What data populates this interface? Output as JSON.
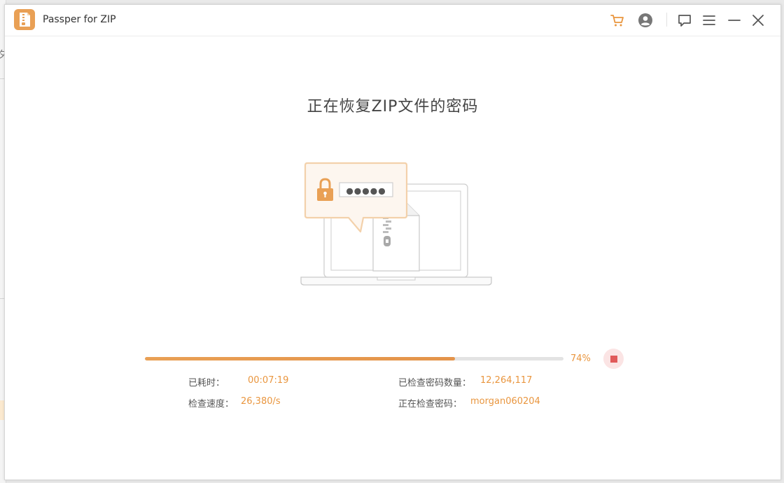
{
  "window": {
    "title": "Passper for ZIP"
  },
  "titlebar": {
    "icons": [
      "cart-icon",
      "account-icon",
      "feedback-icon",
      "menu-icon",
      "minimize-icon",
      "close-icon"
    ]
  },
  "colors": {
    "accent": "#e9963f",
    "stop": "#e05a5a",
    "track": "#e3e3e3"
  },
  "main": {
    "heading": "正在恢复ZIP文件的密码",
    "illustration": {
      "password_dots": "●●●●●"
    },
    "progress": {
      "value": 0.74,
      "label": "74%"
    },
    "stats": {
      "elapsed_label": "已耗时：",
      "elapsed_value": "00:07:19",
      "checked_label": "已检查密码数量：",
      "checked_value": "12,264,117",
      "speed_label": "检查速度：",
      "speed_value": "26,380/s",
      "current_label": "正在检查密码：",
      "current_value": "morgan060204"
    }
  }
}
